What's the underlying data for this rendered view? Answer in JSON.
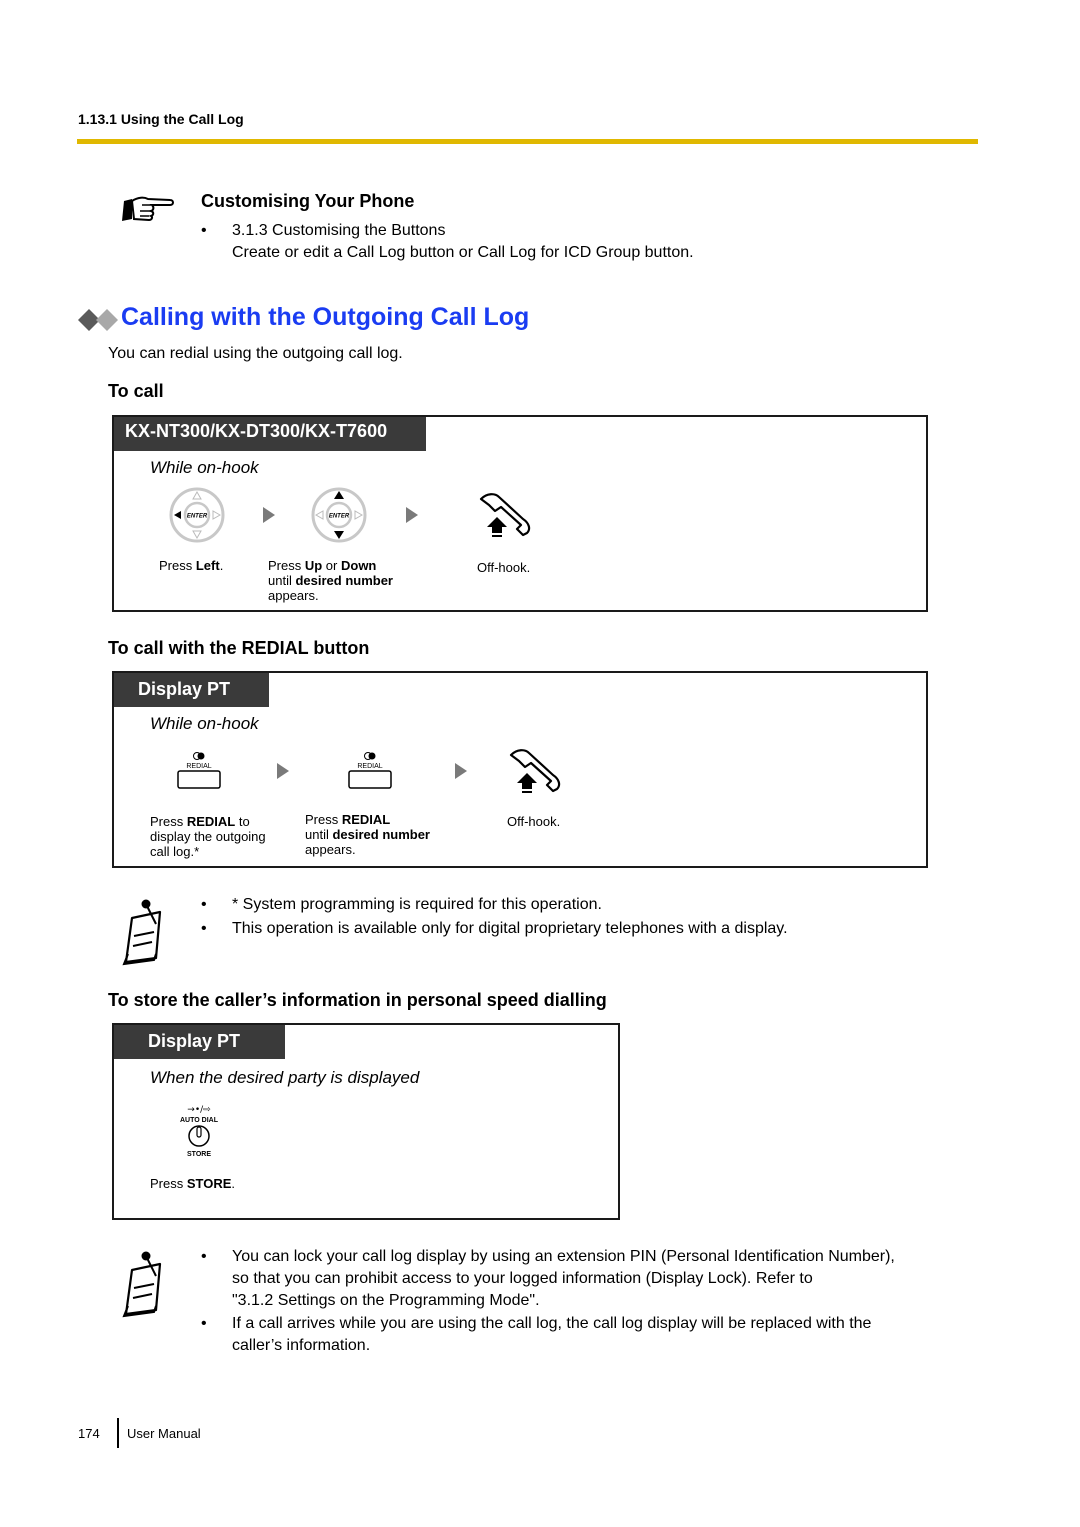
{
  "header": {
    "section": "1.13.1 Using the Call Log",
    "rule_color": "#e0b800"
  },
  "customising": {
    "icon": "pointing-hand-icon",
    "title": "Customising Your Phone",
    "bullet": "•",
    "link": "3.1.3  Customising the Buttons",
    "description": "Create or edit a Call Log button or Call Log for ICD Group button."
  },
  "main": {
    "icon": "diamonds-icon",
    "title": "Calling with the Outgoing Call Log",
    "title_color": "#1a3cf2",
    "intro": "You can redial using the outgoing call log."
  },
  "to_call": {
    "heading": "To call",
    "box": {
      "tag": "KX-NT300/KX-DT300/KX-T7600",
      "condition": "While on-hook",
      "steps": [
        {
          "icon": "navigator-key-left-icon",
          "key_label": "ENTER",
          "text_parts": [
            "Press ",
            "Left",
            "."
          ]
        },
        {
          "icon": "navigator-key-up-down-icon",
          "key_label": "ENTER",
          "text_line1": [
            "Press ",
            "Up",
            " or ",
            "Down"
          ],
          "text_line2": [
            "until ",
            "desired number"
          ],
          "text_line3": "appears."
        },
        {
          "icon": "off-hook-icon",
          "text": "Off-hook."
        }
      ]
    }
  },
  "redial": {
    "heading": "To call with the REDIAL button",
    "box": {
      "tag": "Display PT",
      "condition": "While on-hook",
      "button_label": "REDIAL",
      "steps": [
        {
          "icon": "redial-button-icon",
          "text_line1": [
            "Press ",
            "REDIAL",
            " to"
          ],
          "text_line2": "display the outgoing",
          "text_line3": "call log.*"
        },
        {
          "icon": "redial-button-icon",
          "text_line1": [
            "Press ",
            "REDIAL"
          ],
          "text_line2": [
            "until ",
            "desired number"
          ],
          "text_line3": "appears."
        },
        {
          "icon": "off-hook-icon",
          "text": "Off-hook."
        }
      ]
    },
    "notes": [
      "* System programming is required for this operation.",
      "This operation is available only for digital proprietary telephones with a display."
    ]
  },
  "store": {
    "heading": "To store the caller’s information in personal speed dialling",
    "box": {
      "tag": "Display PT",
      "condition": "When the desired party is displayed",
      "button_top_label": "AUTO DIAL",
      "button_bottom_label": "STORE",
      "button_symbol": "→•/⇨",
      "step_text": [
        "Press ",
        "STORE",
        "."
      ]
    },
    "notes": [
      {
        "lines": [
          "You can lock your call log display by using an extension PIN (Personal Identification Number),",
          "so that you can prohibit access to your logged information (Display Lock). Refer to",
          "\"3.1.2  Settings on the Programming Mode\"."
        ]
      },
      {
        "lines": [
          "If a call arrives while you are using the call log, the call log display will be replaced with the",
          "caller’s information."
        ]
      }
    ]
  },
  "footer": {
    "page_number": "174",
    "title": "User Manual"
  },
  "bullet": "•"
}
